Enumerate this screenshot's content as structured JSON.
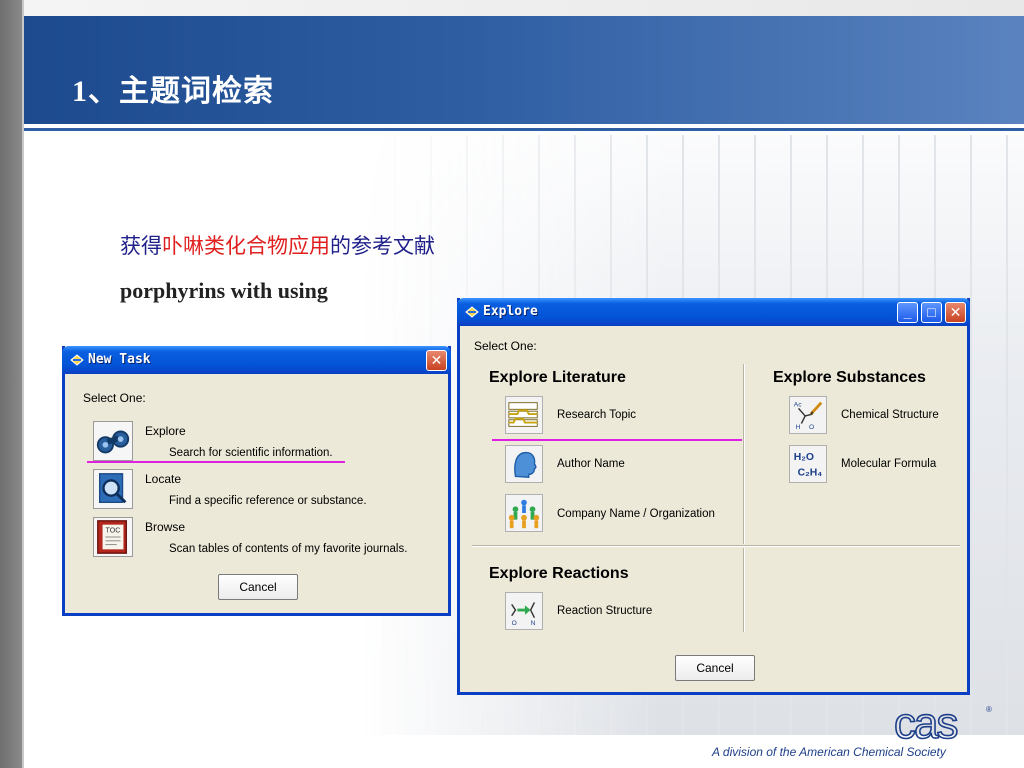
{
  "slide": {
    "title": "1、主题词检索",
    "caption_prefix": "获得",
    "caption_highlight": "卟啉类化合物应用",
    "caption_suffix": "的参考文献",
    "caption_en": "porphyrins with using",
    "footer_tagline": "A division of the American Chemical Society",
    "logo_text": "cas"
  },
  "new_task": {
    "title": "New Task",
    "select_one": "Select One:",
    "items": [
      {
        "title": "Explore",
        "desc": "Search for scientific information.",
        "icon": "binoculars-icon"
      },
      {
        "title": "Locate",
        "desc": "Find a specific reference or substance.",
        "icon": "magnifier-document-icon"
      },
      {
        "title": "Browse",
        "desc": "Scan tables of contents of my favorite journals.",
        "icon": "toc-book-icon",
        "icon_text": "TOC"
      }
    ],
    "cancel": "Cancel"
  },
  "explore": {
    "title": "Explore",
    "select_one": "Select One:",
    "literature": {
      "title": "Explore Literature",
      "items": [
        {
          "label": "Research Topic",
          "icon": "research-topic-icon"
        },
        {
          "label": "Author Name",
          "icon": "author-head-icon"
        },
        {
          "label": "Company Name / Organization",
          "icon": "organization-people-icon"
        }
      ]
    },
    "substances": {
      "title": "Explore Substances",
      "items": [
        {
          "label": "Chemical Structure",
          "icon": "chemical-structure-icon"
        },
        {
          "label": "Molecular Formula",
          "icon": "molecular-formula-icon",
          "icon_line1": "H₂O",
          "icon_line2": "C₂H₄"
        }
      ]
    },
    "reactions": {
      "title": "Explore Reactions",
      "items": [
        {
          "label": "Reaction Structure",
          "icon": "reaction-structure-icon"
        }
      ]
    },
    "cancel": "Cancel"
  },
  "colors": {
    "header_blue": "#2f5ea3",
    "highlight_red": "#e02020",
    "underline_magenta": "#e020e0",
    "xp_title_blue": "#0353d6"
  }
}
